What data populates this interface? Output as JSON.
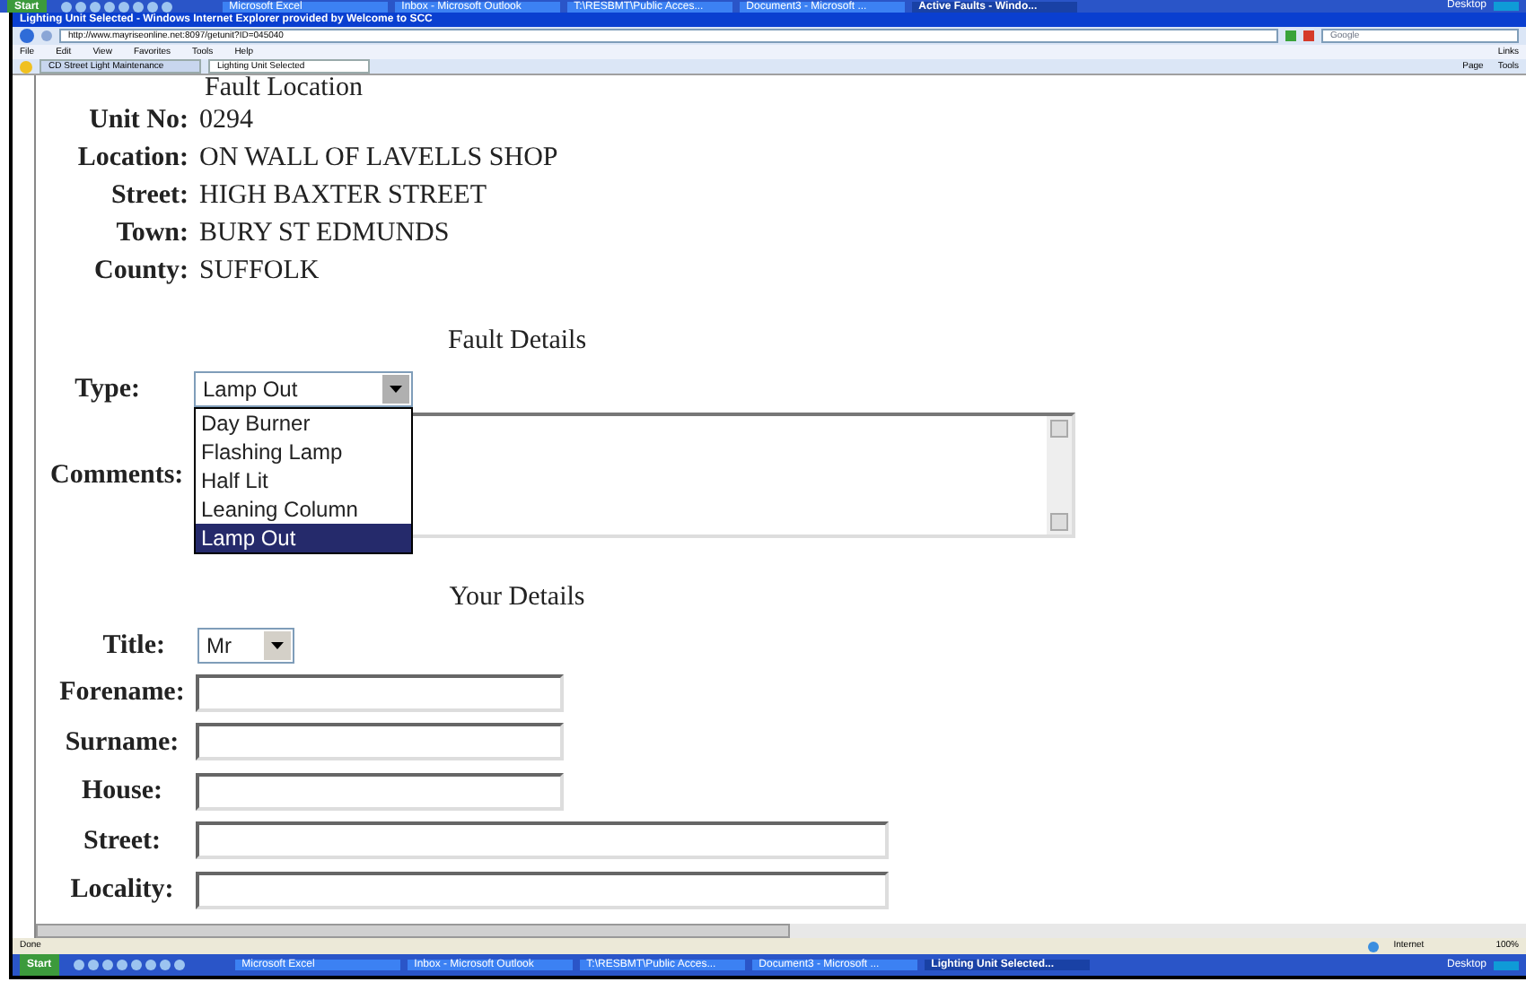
{
  "top_taskbar": {
    "start": "Start",
    "items": [
      {
        "label": "Microsoft Excel",
        "selected": false
      },
      {
        "label": "Inbox - Microsoft Outlook",
        "selected": false
      },
      {
        "label": "T:\\RESBMT\\Public Acces...",
        "selected": false
      },
      {
        "label": "Document3 - Microsoft ...",
        "selected": false
      },
      {
        "label": "Active Faults - Windo...",
        "selected": true
      }
    ],
    "desktop": "Desktop"
  },
  "browser": {
    "title": "Lighting Unit Selected - Windows Internet Explorer provided by Welcome to SCC",
    "address": "http://www.mayriseonline.net:8097/getunit?ID=045040",
    "search_placeholder": "Google",
    "menu": [
      "File",
      "Edit",
      "View",
      "Favorites",
      "Tools",
      "Help"
    ],
    "links": "Links",
    "tabs": [
      {
        "label": "CD Street Light Maintenance",
        "selected": false
      },
      {
        "label": "Lighting Unit Selected",
        "selected": true
      }
    ],
    "toolbar": [
      "Page",
      "Tools"
    ]
  },
  "page": {
    "fault_location": {
      "heading": "Fault Location",
      "fields": [
        {
          "label": "Unit No:",
          "value": "0294"
        },
        {
          "label": "Location:",
          "value": "ON WALL OF LAVELLS SHOP"
        },
        {
          "label": "Street:",
          "value": "HIGH BAXTER STREET"
        },
        {
          "label": "Town:",
          "value": "BURY ST EDMUNDS"
        },
        {
          "label": "County:",
          "value": "SUFFOLK"
        }
      ]
    },
    "fault_details": {
      "heading": "Fault Details",
      "type": {
        "label": "Type:",
        "value": "Lamp Out",
        "expanded": true,
        "options": [
          {
            "label": "Day Burner",
            "selected": false
          },
          {
            "label": "Flashing Lamp",
            "selected": false
          },
          {
            "label": "Half Lit",
            "selected": false
          },
          {
            "label": "Leaning Column",
            "selected": false
          },
          {
            "label": "Lamp Out",
            "selected": true
          }
        ]
      },
      "comments_label": "Comments:"
    },
    "your_details": {
      "heading": "Your Details",
      "title": {
        "label": "Title:",
        "value": "Mr"
      },
      "fields": [
        {
          "label": "Forename:",
          "kind": "short"
        },
        {
          "label": "Surname:",
          "kind": "short"
        },
        {
          "label": "House:",
          "kind": "short"
        },
        {
          "label": "Street:",
          "kind": "long"
        },
        {
          "label": "Locality:",
          "kind": "long"
        }
      ]
    }
  },
  "status_bar": {
    "text": "Done",
    "zone": "Internet",
    "zoom": "100%"
  },
  "taskbar": {
    "start": "Start",
    "items": [
      {
        "label": "Microsoft Excel",
        "selected": false
      },
      {
        "label": "Inbox - Microsoft Outlook",
        "selected": false
      },
      {
        "label": "T:\\RESBMT\\Public Acces...",
        "selected": false
      },
      {
        "label": "Document3 - Microsoft ...",
        "selected": false
      },
      {
        "label": "Lighting Unit Selected...",
        "selected": true
      }
    ],
    "desktop": "Desktop"
  }
}
